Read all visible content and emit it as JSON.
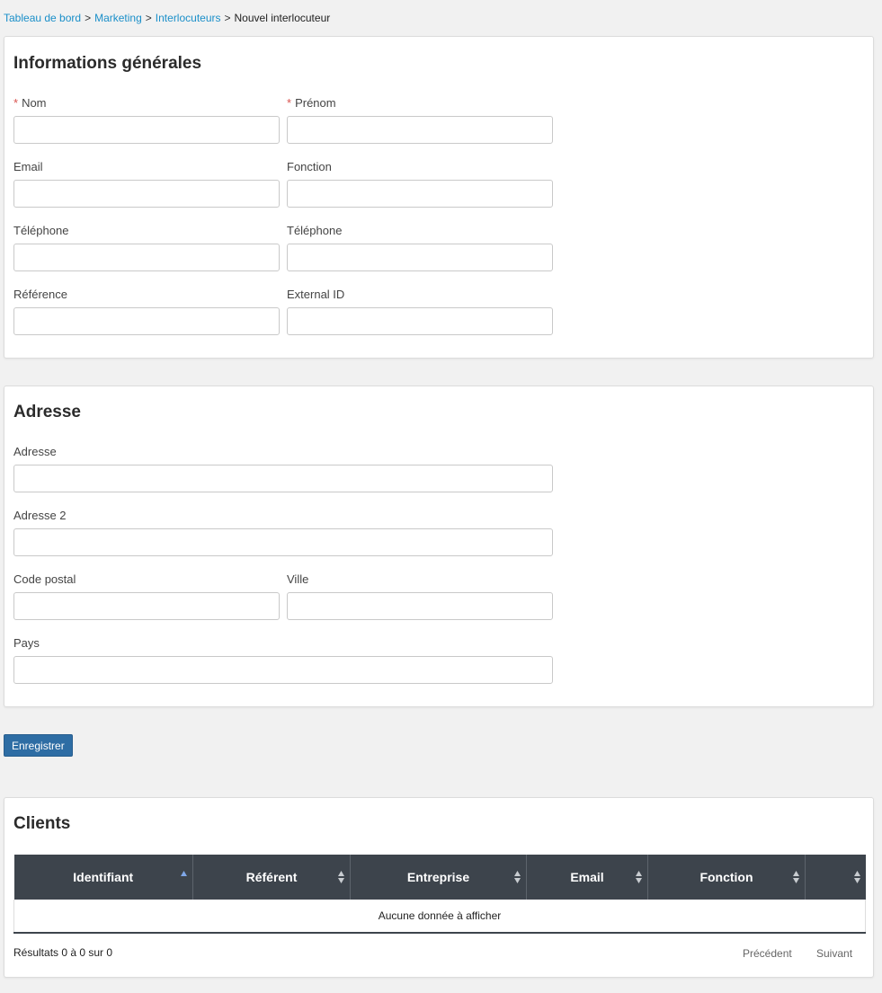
{
  "breadcrumb": {
    "items": [
      {
        "label": "Tableau de bord"
      },
      {
        "label": "Marketing"
      },
      {
        "label": "Interlocuteurs"
      }
    ],
    "current": "Nouvel interlocuteur",
    "separator": ">"
  },
  "general": {
    "title": "Informations générales",
    "required_mark": "*",
    "nom_label": "Nom",
    "prenom_label": "Prénom",
    "email_label": "Email",
    "fonction_label": "Fonction",
    "telephone1_label": "Téléphone",
    "telephone2_label": "Téléphone",
    "reference_label": "Référence",
    "external_id_label": "External ID"
  },
  "address": {
    "title": "Adresse",
    "adresse_label": "Adresse",
    "adresse2_label": "Adresse 2",
    "code_postal_label": "Code postal",
    "ville_label": "Ville",
    "pays_label": "Pays"
  },
  "save_label": "Enregistrer",
  "clients": {
    "title": "Clients",
    "columns": [
      "Identifiant",
      "Référent",
      "Entreprise",
      "Email",
      "Fonction",
      ""
    ],
    "sorted_column": "Identifiant",
    "sort_direction": "asc",
    "empty_message": "Aucune donnée à afficher",
    "results_info": "Résultats 0 à 0 sur 0",
    "prev_label": "Précédent",
    "next_label": "Suivant"
  },
  "colors": {
    "link": "#1a8fc9",
    "required": "#d9534f",
    "button": "#2e6da4",
    "table_header": "#3d444c",
    "sort_active": "#7fa7e8"
  }
}
